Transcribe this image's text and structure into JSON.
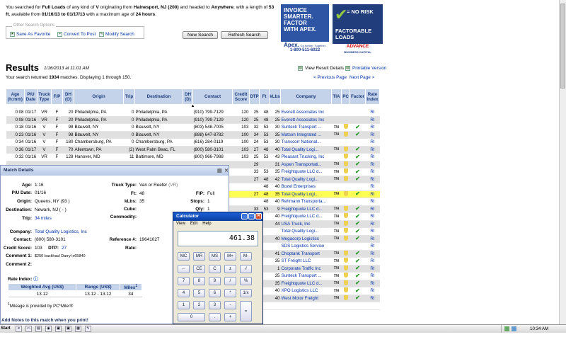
{
  "search": {
    "p1": "You searched for",
    "full": "Full Loads",
    "p2": "of any kind of",
    "v": "V",
    "p3": "originating from",
    "origin": "Hainesport, NJ (200)",
    "p4": "and headed to",
    "dest": "Anywhere",
    "p5": ", with a length of",
    "len": "53 ft",
    "p6": ", available from",
    "dates": "01/16/13 to 01/17/13",
    "p7": "with a maximum age of",
    "age": "24 hours",
    "p8": "."
  },
  "options": {
    "legend": "Other Search Options",
    "save": "Save As Favorite",
    "convert": "Convert To Post",
    "modify": "Modify Search"
  },
  "buttons": {
    "new": "New Search",
    "refresh": "Refresh Search"
  },
  "ads": {
    "apex": {
      "line1": "INVOICE",
      "line2": "SMARTER.",
      "line3": "FACTOR",
      "line4": "WITH APEX.",
      "logo": "Apex.",
      "tag": "Go further. Together.",
      "phone": "1-800-511-6022"
    },
    "advance": {
      "sym": "=",
      "line1": "NO RISK",
      "line2": "FACTORABLE",
      "line3": "LOADS",
      "logo": "ADVANCE",
      "sub": "BUSINESS CAPITAL"
    }
  },
  "results": {
    "title": "Results",
    "date": "1/16/2013 at 11:01 AM",
    "count_pre": "Your search returned",
    "count": "1934",
    "count_post": "matches. Displaying 1 through 150.",
    "view_details": "View Result Details",
    "printable": "Printable Version",
    "prev": "< Previous Page",
    "next": "Next Page >"
  },
  "table": {
    "headers": [
      "Age (h:mm)",
      "P/U Date",
      "Truck Type",
      "F/P",
      "DH (O)",
      "Origin",
      "Trip",
      "Destination",
      "DH (D)",
      "Contact",
      "Credit Score",
      "DTP",
      "Ft",
      "kLbs",
      "Company",
      "TIA",
      "PC",
      "Factor",
      "Rate Index"
    ],
    "rows": [
      {
        "age": "0:08",
        "pu": "01/17",
        "tt": "VR",
        "fp": "F",
        "dho": "20",
        "origin": "Philadelphia, PA",
        "trip": "0",
        "dest": "Philadelphia, PA",
        "dhd": "",
        "contact": "(910) 799-7129",
        "cs": "120",
        "dtp": "25",
        "ft": "48",
        "kl": "25",
        "co": "Everett Associates Inc",
        "tia": "",
        "pc": "",
        "fac": "",
        "ri": "RI",
        "shade": ""
      },
      {
        "age": "0:08",
        "pu": "01/16",
        "tt": "VR",
        "fp": "F",
        "dho": "20",
        "origin": "Philadelphia, PA",
        "trip": "0",
        "dest": "Philadelphia, PA",
        "dhd": "",
        "contact": "(910) 799-7129",
        "cs": "120",
        "dtp": "25",
        "ft": "48",
        "kl": "25",
        "co": "Everett Associates Inc",
        "tia": "",
        "pc": "",
        "fac": "",
        "ri": "RI",
        "shade": "gray"
      },
      {
        "age": "0:18",
        "pu": "01/16",
        "tt": "V",
        "fp": "F",
        "dho": "98",
        "origin": "Blauvelt, NY",
        "trip": "0",
        "dest": "Blauvelt, NY",
        "dhd": "",
        "contact": "(803) 548-7005",
        "cs": "103",
        "dtp": "32",
        "ft": "53",
        "kl": "30",
        "co": "Sunteck Transport ...",
        "tia": "TIA",
        "pc": "s",
        "fac": "y",
        "ri": "RI",
        "shade": ""
      },
      {
        "age": "0:23",
        "pu": "01/16",
        "tt": "V",
        "fp": "F",
        "dho": "98",
        "origin": "Blauvelt, NY",
        "trip": "0",
        "dest": "Blauvelt, NY",
        "dhd": "",
        "contact": "(888) 647-8782",
        "cs": "100",
        "dtp": "34",
        "ft": "53",
        "kl": "35",
        "co": "Matson Integrated ...",
        "tia": "TIA",
        "pc": "s",
        "fac": "y",
        "ri": "RI",
        "shade": "gray"
      },
      {
        "age": "0:34",
        "pu": "01/16",
        "tt": "V",
        "fp": "F",
        "dho": "180",
        "origin": "Chambersburg, PA",
        "trip": "0",
        "dest": "Chambersburg, PA",
        "dhd": "",
        "contact": "(616) 284-0119",
        "cs": "100",
        "dtp": "24",
        "ft": "53",
        "kl": "30",
        "co": "Transcorr National...",
        "tia": "",
        "pc": "",
        "fac": "",
        "ri": "RI",
        "shade": ""
      },
      {
        "age": "0:36",
        "pu": "01/17",
        "tt": "V",
        "fp": "F",
        "dho": "70",
        "origin": "Allentown, PA",
        "trip": "(2)",
        "dest": "West Palm Beac, FL",
        "dhd": "",
        "contact": "(800) 580-3101",
        "cs": "103",
        "dtp": "27",
        "ft": "48",
        "kl": "40",
        "co": "Total Quality Logi...",
        "tia": "TIA",
        "pc": "s",
        "fac": "y",
        "ri": "RI",
        "shade": "gray"
      },
      {
        "age": "0:32",
        "pu": "01/16",
        "tt": "VR",
        "fp": "F",
        "dho": "128",
        "origin": "Hanover, MD",
        "trip": "11",
        "dest": "Baltimore, MD",
        "dhd": "",
        "contact": "(800) 966-7988",
        "cs": "103",
        "dtp": "25",
        "ft": "53",
        "kl": "43",
        "co": "Pleasant Trucking, Inc",
        "tia": "",
        "pc": "s",
        "fac": "y",
        "ri": "RI",
        "shade": ""
      },
      {
        "age": "",
        "pu": "",
        "tt": "",
        "fp": "",
        "dho": "",
        "origin": "",
        "trip": "",
        "dest": "",
        "dhd": "",
        "contact": "",
        "cs": "",
        "dtp": "29",
        "ft": "",
        "kl": "31",
        "co": "Aspen Transportati...",
        "tia": "TIA",
        "pc": "s",
        "fac": "y",
        "ri": "RI",
        "shade": "gray"
      },
      {
        "age": "",
        "pu": "",
        "tt": "",
        "fp": "",
        "dho": "",
        "origin": "",
        "trip": "",
        "dest": "",
        "dhd": "",
        "contact": "",
        "cs": "",
        "dtp": "33",
        "ft": "53",
        "kl": "35",
        "co": "Freightquote LLC d...",
        "tia": "TIA",
        "pc": "s",
        "fac": "y",
        "ri": "RI",
        "shade": ""
      },
      {
        "age": "",
        "pu": "",
        "tt": "",
        "fp": "",
        "dho": "",
        "origin": "",
        "trip": "",
        "dest": "",
        "dhd": "",
        "contact": "",
        "cs": "",
        "dtp": "27",
        "ft": "48",
        "kl": "42",
        "co": "Total Quality Logi...",
        "tia": "TIA",
        "pc": "s",
        "fac": "y",
        "ri": "RI",
        "shade": "gray"
      },
      {
        "age": "",
        "pu": "",
        "tt": "",
        "fp": "",
        "dho": "",
        "origin": "",
        "trip": "",
        "dest": "",
        "dhd": "",
        "contact": "",
        "cs": "",
        "dtp": "",
        "ft": "48",
        "kl": "40",
        "co": "Bozel Enterprises",
        "tia": "",
        "pc": "",
        "fac": "",
        "ri": "RI",
        "shade": ""
      },
      {
        "age": "",
        "pu": "",
        "tt": "",
        "fp": "",
        "dho": "",
        "origin": "",
        "trip": "",
        "dest": "",
        "dhd": "",
        "contact": "",
        "cs": "",
        "dtp": "27",
        "ft": "48",
        "kl": "35",
        "co": "Total Quality Logi...",
        "tia": "TIA",
        "pc": "s",
        "fac": "y",
        "ri": "RI",
        "shade": "yel"
      },
      {
        "age": "",
        "pu": "",
        "tt": "",
        "fp": "",
        "dho": "",
        "origin": "",
        "trip": "",
        "dest": "",
        "dhd": "",
        "contact": "",
        "cs": "",
        "dtp": "",
        "ft": "48",
        "kl": "40",
        "co": "Rehmann Transporta...",
        "tia": "",
        "pc": "",
        "fac": "",
        "ri": "RI",
        "shade": ""
      },
      {
        "age": "",
        "pu": "",
        "tt": "",
        "fp": "",
        "dho": "",
        "origin": "",
        "trip": "",
        "dest": "",
        "dhd": "",
        "contact": "",
        "cs": "",
        "dtp": "33",
        "ft": "53",
        "kl": "9",
        "co": "Freightquote LLC d...",
        "tia": "TIA",
        "pc": "s",
        "fac": "y",
        "ri": "RI",
        "shade": "gray"
      },
      {
        "age": "",
        "pu": "",
        "tt": "",
        "fp": "",
        "dho": "",
        "origin": "",
        "trip": "",
        "dest": "",
        "dhd": "",
        "contact": "",
        "cs": "",
        "dtp": "",
        "ft": "",
        "kl": "40",
        "co": "Freightquote LLC d...",
        "tia": "TIA",
        "pc": "s",
        "fac": "y",
        "ri": "RI",
        "shade": ""
      },
      {
        "age": "",
        "pu": "",
        "tt": "",
        "fp": "",
        "dho": "",
        "origin": "",
        "trip": "",
        "dest": "",
        "dhd": "",
        "contact": "",
        "cs": "",
        "dtp": "",
        "ft": "",
        "kl": "44",
        "co": "USA Truck, Inc",
        "tia": "TIA",
        "pc": "s",
        "fac": "y",
        "ri": "RI",
        "shade": "gray"
      },
      {
        "age": "",
        "pu": "",
        "tt": "",
        "fp": "",
        "dho": "",
        "origin": "",
        "trip": "",
        "dest": "",
        "dhd": "",
        "contact": "",
        "cs": "",
        "dtp": "",
        "ft": "",
        "kl": "",
        "co": "Total Quality Logi...",
        "tia": "TIA",
        "pc": "s",
        "fac": "y",
        "ri": "RI",
        "shade": ""
      },
      {
        "age": "",
        "pu": "",
        "tt": "",
        "fp": "",
        "dho": "",
        "origin": "",
        "trip": "",
        "dest": "",
        "dhd": "",
        "contact": "",
        "cs": "",
        "dtp": "",
        "ft": "",
        "kl": "40",
        "co": "Megacorp Logistics",
        "tia": "TIA",
        "pc": "s",
        "fac": "y",
        "ri": "RI",
        "shade": "gray"
      },
      {
        "age": "",
        "pu": "",
        "tt": "",
        "fp": "",
        "dho": "",
        "origin": "",
        "trip": "",
        "dest": "",
        "dhd": "",
        "contact": "",
        "cs": "",
        "dtp": "",
        "ft": "",
        "kl": "",
        "co": "SDS Logistics Service",
        "tia": "",
        "pc": "",
        "fac": "",
        "ri": "RI",
        "shade": ""
      },
      {
        "age": "",
        "pu": "",
        "tt": "",
        "fp": "",
        "dho": "",
        "origin": "",
        "trip": "",
        "dest": "",
        "dhd": "",
        "contact": "",
        "cs": "",
        "dtp": "",
        "ft": "",
        "kl": "41",
        "co": "Choptank Transport",
        "tia": "TIA",
        "pc": "s",
        "fac": "y",
        "ri": "RI",
        "shade": "gray"
      },
      {
        "age": "",
        "pu": "",
        "tt": "",
        "fp": "",
        "dho": "",
        "origin": "",
        "trip": "",
        "dest": "",
        "dhd": "",
        "contact": "",
        "cs": "",
        "dtp": "",
        "ft": "",
        "kl": "35",
        "co": "ST Freight LLC",
        "tia": "TIA",
        "pc": "s",
        "fac": "y",
        "ri": "RI",
        "shade": ""
      },
      {
        "age": "",
        "pu": "",
        "tt": "",
        "fp": "",
        "dho": "",
        "origin": "",
        "trip": "",
        "dest": "",
        "dhd": "",
        "contact": "",
        "cs": "",
        "dtp": "",
        "ft": "",
        "kl": "1",
        "co": "Corporate Traffic Inc",
        "tia": "TIA",
        "pc": "s",
        "fac": "y",
        "ri": "RI",
        "shade": "gray"
      },
      {
        "age": "",
        "pu": "",
        "tt": "",
        "fp": "",
        "dho": "",
        "origin": "",
        "trip": "",
        "dest": "",
        "dhd": "",
        "contact": "",
        "cs": "",
        "dtp": "",
        "ft": "",
        "kl": "35",
        "co": "Sunteck Transport ...",
        "tia": "TIA",
        "pc": "s",
        "fac": "y",
        "ri": "RI",
        "shade": ""
      },
      {
        "age": "",
        "pu": "",
        "tt": "",
        "fp": "",
        "dho": "",
        "origin": "",
        "trip": "",
        "dest": "",
        "dhd": "",
        "contact": "",
        "cs": "",
        "dtp": "",
        "ft": "",
        "kl": "35",
        "co": "Freightquote LLC d...",
        "tia": "TIA",
        "pc": "s",
        "fac": "y",
        "ri": "RI",
        "shade": "gray"
      },
      {
        "age": "",
        "pu": "",
        "tt": "",
        "fp": "",
        "dho": "",
        "origin": "",
        "trip": "",
        "dest": "",
        "dhd": "",
        "contact": "",
        "cs": "",
        "dtp": "",
        "ft": "",
        "kl": "40",
        "co": "XPO Logistics LLC",
        "tia": "TIA",
        "pc": "s",
        "fac": "y",
        "ri": "RI",
        "shade": ""
      },
      {
        "age": "",
        "pu": "",
        "tt": "",
        "fp": "",
        "dho": "",
        "origin": "",
        "trip": "",
        "dest": "",
        "dhd": "",
        "contact": "",
        "cs": "",
        "dtp": "",
        "ft": "",
        "kl": "40",
        "co": "West Motor Freight",
        "tia": "TIA",
        "pc": "s",
        "fac": "y",
        "ri": "RI",
        "shade": "gray"
      },
      {
        "age": "",
        "pu": "",
        "tt": "",
        "fp": "",
        "dho": "",
        "origin": "",
        "trip": "",
        "dest": "",
        "dhd": "",
        "contact": "",
        "cs": "",
        "dtp": "",
        "ft": "",
        "kl": "",
        "co": "",
        "tia": "",
        "pc": "",
        "fac": "",
        "ri": "",
        "shade": ""
      }
    ]
  },
  "match": {
    "title": "Match Details",
    "age_l": "Age:",
    "age": "1:16",
    "pu_l": "P/U Date:",
    "pu": "01/16",
    "origin_l": "Origin:",
    "origin": "Queens, NY (93 )",
    "dest_l": "Destination:",
    "dest": "Newark, NJ ( - )",
    "trip_l": "Trip:",
    "trip": "34 miles",
    "tt_l": "Truck Type:",
    "tt": "Van or Reefer",
    "tt_code": "(VR)",
    "ft_l": "Ft:",
    "ft": "48",
    "klbs_l": "kLbs:",
    "klbs": "35",
    "cube_l": "Cube:",
    "cube": "",
    "comm_l": "Commodity:",
    "comm": "",
    "fp_l": "F/P:",
    "fp": "Full",
    "stops_l": "Stops:",
    "stops": "1",
    "qty_l": "Qty:",
    "qty": "1",
    "company_l": "Company:",
    "company": "Total Quality Logistics, Inc",
    "contact_l": "Contact:",
    "contact": "(800) 580-3101",
    "ref_l": "Reference #:",
    "ref": "19641027",
    "cs_l": "Credit Score:",
    "cs": "103",
    "dtp_l": "DTP:",
    "dtp": "27",
    "rate_l": "Rate:",
    "rate": "",
    "c1_l": "Comment 1:",
    "c1": "$250 backhaul Darryl x65840",
    "c2_l": "Comment 2:",
    "c2": "",
    "ri_title": "Rate Index:",
    "ri_h1": "Weighted Avg (US$)",
    "ri_h2": "Range (US$)",
    "ri_h3": "Miles",
    "ri_h3_sup": "1",
    "ri_avg": "13.12",
    "ri_range": "13.12 - 13.12",
    "ri_miles": "34",
    "footnote_sup": "1",
    "footnote": "Mileage is provided by PC*Miler®",
    "notes": "Add Notes to this match when you print!"
  },
  "calc": {
    "title": "Calculator",
    "menu": [
      "View",
      "Edit",
      "Help"
    ],
    "display": "461.38",
    "keys": [
      "MC",
      "MR",
      "MS",
      "M+",
      "M-",
      "←",
      "CE",
      "C",
      "±",
      "√",
      "7",
      "8",
      "9",
      "/",
      "%",
      "4",
      "5",
      "6",
      "*",
      "1/x",
      "1",
      "2",
      "3",
      "-",
      "=",
      "0",
      ".",
      "+"
    ]
  },
  "taskbar": {
    "start": "Start",
    "time": "10:34 AM"
  }
}
